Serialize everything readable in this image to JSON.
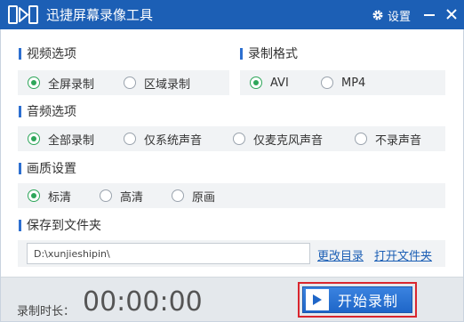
{
  "window": {
    "title": "迅捷屏幕录像工具",
    "settings_label": "设置"
  },
  "video": {
    "title": "视频选项",
    "options": [
      "全屏录制",
      "区域录制"
    ],
    "selected": "全屏录制"
  },
  "format": {
    "title": "录制格式",
    "options": [
      "AVI",
      "MP4"
    ],
    "selected": "AVI"
  },
  "audio": {
    "title": "音频选项",
    "options": [
      "全部录制",
      "仅系统声音",
      "仅麦克风声音",
      "不录声音"
    ],
    "selected": "全部录制"
  },
  "quality": {
    "title": "画质设置",
    "options": [
      "标清",
      "高清",
      "原画"
    ],
    "selected": "标清"
  },
  "save": {
    "title": "保存到文件夹",
    "path": "D:\\xunjieshipin\\",
    "change_dir": "更改目录",
    "open_folder": "打开文件夹"
  },
  "footer": {
    "duration_label": "录制时长：",
    "duration_value": "00:00:00",
    "start_label": "开始录制"
  },
  "colors": {
    "titlebar": "#1c5fb5",
    "accent": "#2d6fd0",
    "radio_checked": "#2ea65a",
    "link": "#1c5fb5",
    "highlight": "#d9262e"
  }
}
